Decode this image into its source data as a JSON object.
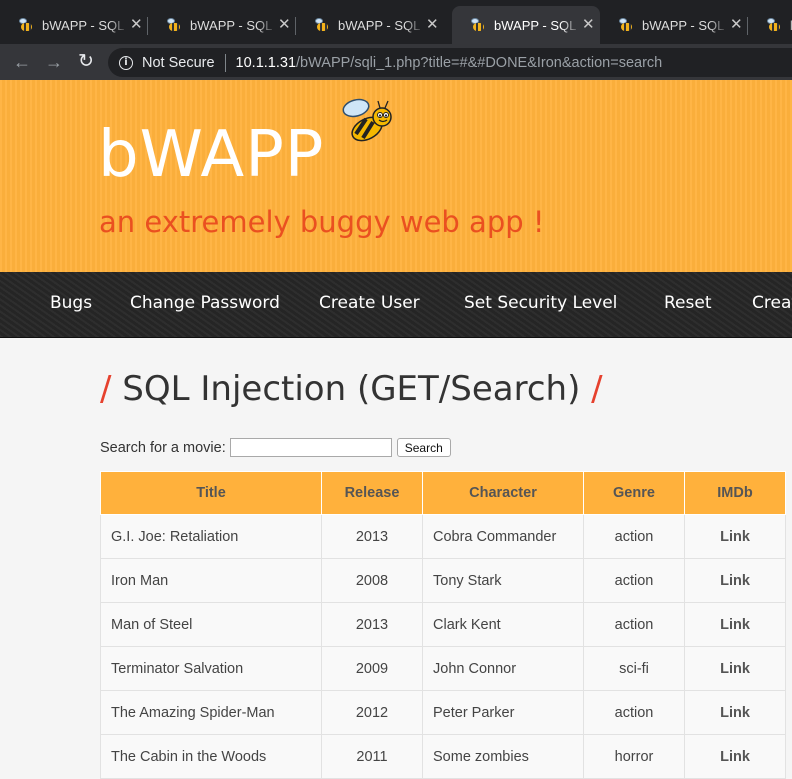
{
  "tabs": [
    {
      "title": "bWAPP - SQL Injection",
      "close": "✕",
      "active": false
    },
    {
      "title": "bWAPP - SQL Injection",
      "close": "✕",
      "active": false
    },
    {
      "title": "bWAPP - SQL Injection",
      "close": "✕",
      "active": false
    },
    {
      "title": "bWAPP - SQL Injection",
      "close": "✕",
      "active": true
    },
    {
      "title": "bWAPP - SQL Injection",
      "close": "✕",
      "active": false
    },
    {
      "title": "bWAPP - SQL Injection",
      "close": "",
      "active": false
    }
  ],
  "toolbar": {
    "back_icon": "←",
    "forward_icon": "→",
    "reload_icon": "↻",
    "security_text": "Not Secure",
    "url_host": "10.1.1.31",
    "url_path": "/bWAPP/sqli_1.php?title=#&#DONE&Iron&action=search"
  },
  "header": {
    "logo": "bWAPP",
    "tagline": "an extremely buggy web app !"
  },
  "menu": [
    "Bugs",
    "Change Password",
    "Create User",
    "Set Security Level",
    "Reset",
    "Creat"
  ],
  "page": {
    "title": "SQL Injection (GET/Search)",
    "slash": "/",
    "search_label": "Search for a movie:",
    "search_value": "",
    "search_button": "Search"
  },
  "table": {
    "headers": [
      "Title",
      "Release",
      "Character",
      "Genre",
      "IMDb"
    ],
    "rows": [
      [
        "G.I. Joe: Retaliation",
        "2013",
        "Cobra Commander",
        "action",
        "Link"
      ],
      [
        "Iron Man",
        "2008",
        "Tony Stark",
        "action",
        "Link"
      ],
      [
        "Man of Steel",
        "2013",
        "Clark Kent",
        "action",
        "Link"
      ],
      [
        "Terminator Salvation",
        "2009",
        "John Connor",
        "sci-fi",
        "Link"
      ],
      [
        "The Amazing Spider-Man",
        "2012",
        "Peter Parker",
        "action",
        "Link"
      ],
      [
        "The Cabin in the Woods",
        "2011",
        "Some zombies",
        "horror",
        "Link"
      ]
    ]
  },
  "colors": {
    "header_orange": "#ffb13c",
    "tagline_red": "#ea5020",
    "menu_dark": "#272727",
    "title_slash": "#e6412e"
  }
}
